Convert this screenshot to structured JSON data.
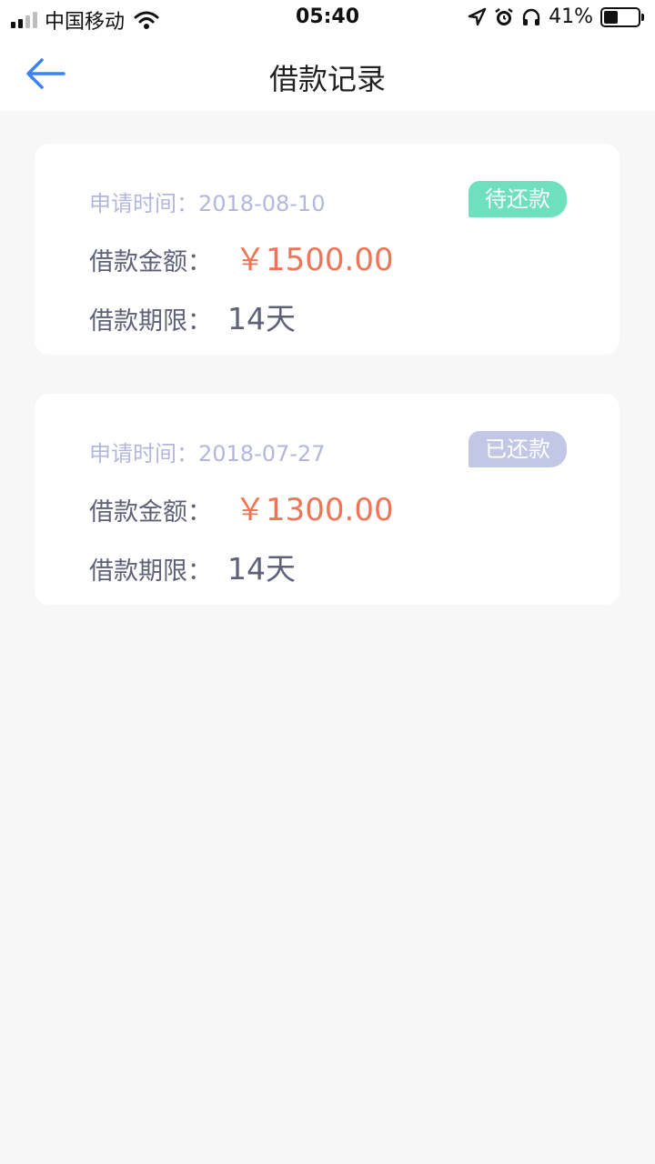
{
  "status_bar": {
    "carrier": "中国移动",
    "time": "05:40",
    "battery_text": "41%",
    "battery_level": 0.41,
    "icons": [
      "signal-icon",
      "wifi-icon",
      "location-icon",
      "alarm-icon",
      "headphones-icon",
      "battery-icon"
    ]
  },
  "nav": {
    "title": "借款记录",
    "back_icon": "arrow-left-icon"
  },
  "colors": {
    "accent": "#3b82f6",
    "pending_badge": "#6ee0be",
    "repaid_badge": "#c3c7e6",
    "amount": "#f07456"
  },
  "records": [
    {
      "date_label": "申请时间：2018-08-10",
      "status": "待还款",
      "status_type": "pending",
      "amount_label": "借款金额：",
      "amount": "￥1500.00",
      "term_label": "借款期限：",
      "term": "14天"
    },
    {
      "date_label": "申请时间：2018-07-27",
      "status": "已还款",
      "status_type": "repaid",
      "amount_label": "借款金额：",
      "amount": "￥1300.00",
      "term_label": "借款期限：",
      "term": "14天"
    }
  ]
}
